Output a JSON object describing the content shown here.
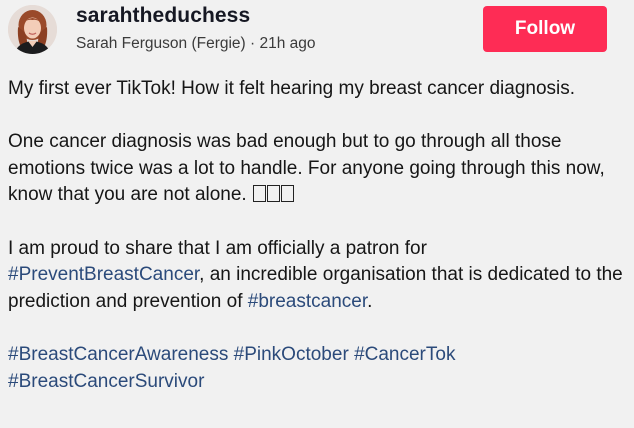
{
  "author": {
    "username": "sarahtheduchess",
    "display_name": "Sarah Ferguson (Fergie)",
    "separator": "·",
    "time_ago": "21h ago",
    "avatar_icon": "profile-photo"
  },
  "follow_button": {
    "label": "Follow",
    "color": "#fe2c55"
  },
  "caption": {
    "p1": "My first ever TikTok! How it felt hearing my breast cancer diagnosis.",
    "p2_text": "One cancer diagnosis was bad enough but to go through all those emotions twice was a lot to handle. For anyone going through this now, know that you are not alone.",
    "p2_emoji_glyphs": "unrendered-emoji-boxes x3",
    "p3_before": "I am proud to share that I am officially a patron for ",
    "p3_tag1": "#PreventBreastCancer",
    "p3_middle": ", an incredible organisation that is dedicated to the prediction and prevention of ",
    "p3_tag2": "#breastcancer",
    "p3_after": ".",
    "tags": [
      "#BreastCancerAwareness",
      "#PinkOctober",
      "#CancerTok",
      "#BreastCancerSurvivor"
    ]
  },
  "colors": {
    "hashtag": "#2b4a7a",
    "background": "#f1f1f1"
  }
}
